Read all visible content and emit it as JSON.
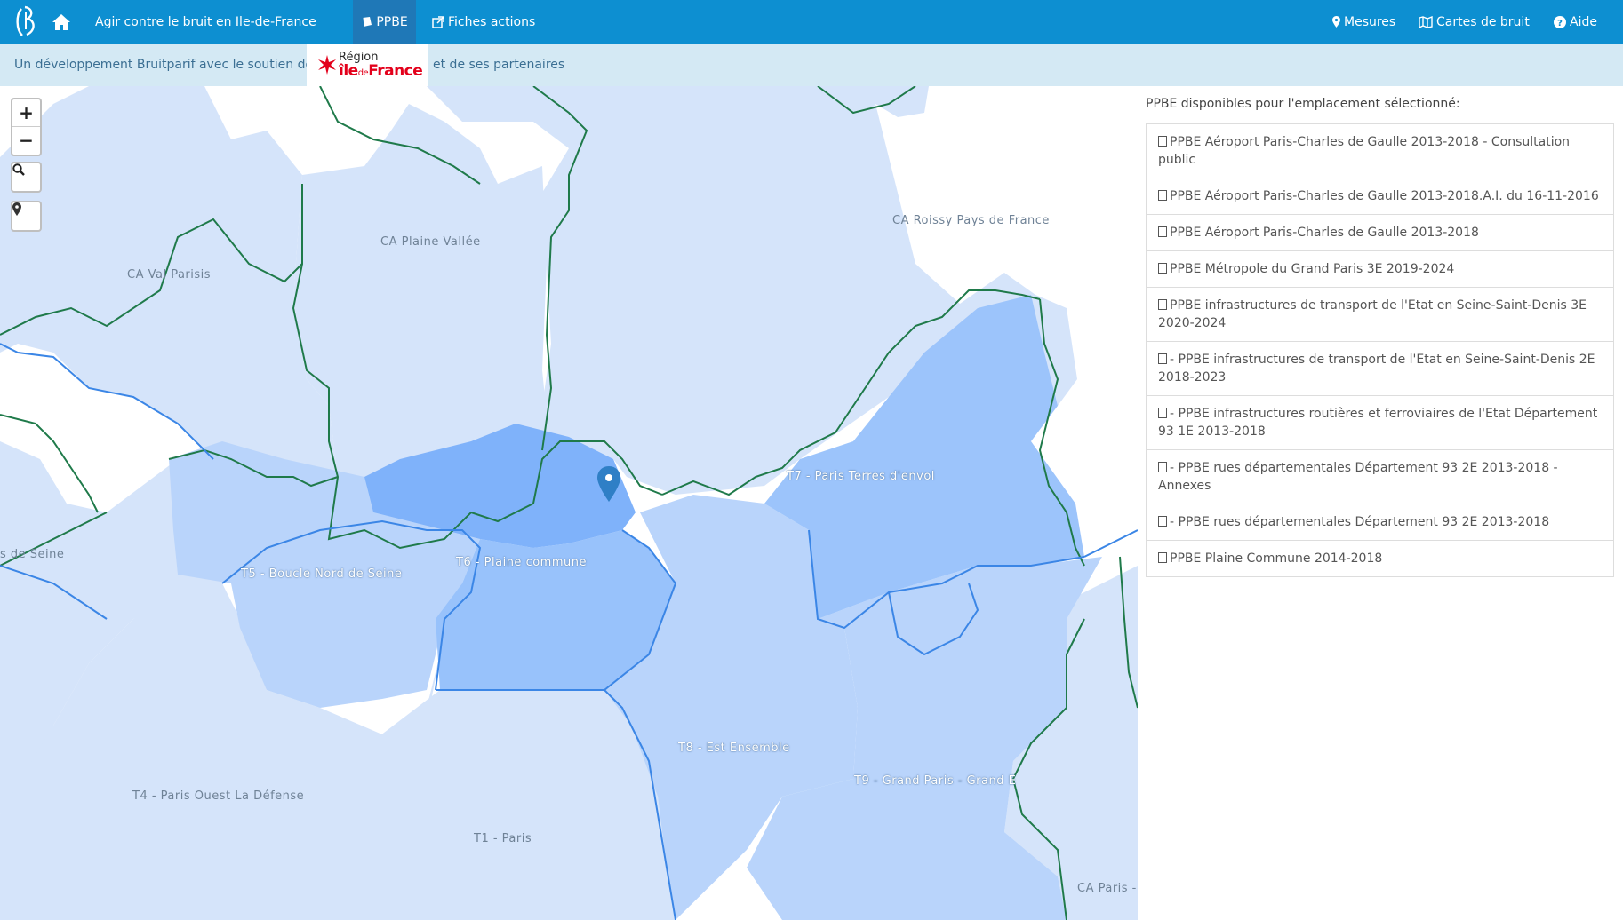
{
  "navbar": {
    "logo_icon": "bruitparif-logo-icon",
    "home_icon": "home-icon",
    "site_title": "Agir contre le bruit en Ile-de-France",
    "tabs": [
      {
        "label": "PPBE",
        "icon": "book-icon",
        "active": true
      },
      {
        "label": "Fiches actions",
        "icon": "external-link-icon",
        "active": false
      }
    ],
    "right_items": [
      {
        "label": "Mesures",
        "icon": "map-marker-icon"
      },
      {
        "label": "Cartes de bruit",
        "icon": "map-icon"
      },
      {
        "label": "Aide",
        "icon": "question-circle-icon"
      }
    ],
    "color": "#0d8fd1"
  },
  "subheader": {
    "text_before": "Un développement Bruitparif avec le soutien de",
    "region_line1": "Région",
    "region_line2_a": "île",
    "region_line2_b": "de",
    "region_line2_c": "France",
    "text_after": "et de ses partenaires"
  },
  "map": {
    "controls": {
      "zoom_in": "+",
      "zoom_out": "−",
      "search_icon": "search-icon",
      "locate_icon": "map-marker-icon"
    },
    "labels": {
      "ca_val_parisis": "CA Val Parisis",
      "ca_plaine_vallee": "CA Plaine Vallée",
      "ca_roissy": "CA Roissy Pays de France",
      "seine_partial": "s de Seine",
      "t5": "T5 - Boucle Nord de Seine",
      "t6": "T6 - Plaine commune",
      "t7": "T7 - Paris Terres d'envol",
      "t8": "T8 - Est Ensemble",
      "t9": "T9 - Grand Paris - Grand E",
      "t4": "T4 - Paris Ouest La Défense",
      "t1": "T1 - Paris",
      "ca_paris": "CA Paris -"
    },
    "colors": {
      "base": "#d5e4fa",
      "t_light": "#b9d4fb",
      "t7": "#9cc4fb",
      "t6": "#98c2fb",
      "selected": "#7fb2fa",
      "green_border": "#1f7a4a",
      "blue_border": "#3b86e6"
    }
  },
  "panel": {
    "title": "PPBE disponibles pour l'emplacement sélectionné:",
    "items": [
      "PPBE Aéroport Paris-Charles de Gaulle 2013-2018 - Consultation public",
      "PPBE Aéroport Paris-Charles de Gaulle 2013-2018.A.I. du 16-11-2016",
      "PPBE Aéroport Paris-Charles de Gaulle 2013-2018",
      "PPBE Métropole du Grand Paris 3E 2019-2024",
      "PPBE infrastructures de transport de l'Etat en Seine-Saint-Denis 3E 2020-2024",
      "- PPBE infrastructures de transport de l'Etat en Seine-Saint-Denis 2E 2018-2023",
      "- PPBE infrastructures routières et ferroviaires de l'Etat Département 93 1E 2013-2018",
      "- PPBE rues départementales Département 93 2E 2013-2018 - Annexes",
      "- PPBE rues départementales Département 93 2E 2013-2018",
      "PPBE Plaine Commune 2014-2018"
    ]
  }
}
